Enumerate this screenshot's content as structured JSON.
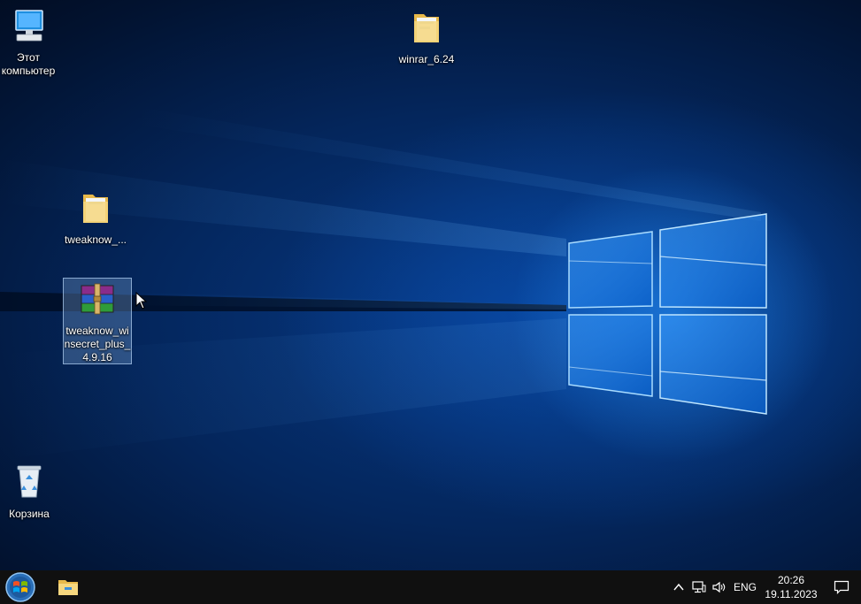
{
  "desktop": {
    "icons": [
      {
        "label": "Этот компьютер",
        "icon": "this-pc-monitor-icon"
      },
      {
        "label": "winrar_6.24",
        "icon": "folder-icon"
      },
      {
        "label": "tweaknow_...",
        "icon": "folder-icon"
      },
      {
        "label": "tweaknow_winsecret_plus_4.9.16",
        "icon": "winrar-archive-icon",
        "selected": true
      },
      {
        "label": "Корзина",
        "icon": "recycle-bin-icon"
      }
    ]
  },
  "taskbar": {
    "start_icon": "start-orb-icon",
    "pinned": [
      {
        "icon": "file-explorer-icon"
      }
    ],
    "tray": {
      "language": "ENG",
      "time": "20:26",
      "date": "19.11.2023",
      "icons": [
        "chevron-up-icon",
        "network-icon",
        "volume-icon",
        "action-center-icon"
      ]
    }
  },
  "colors": {
    "taskbar": "#101010",
    "wallpaper_dark": "#021331",
    "wallpaper_glow": "#2896ff"
  }
}
